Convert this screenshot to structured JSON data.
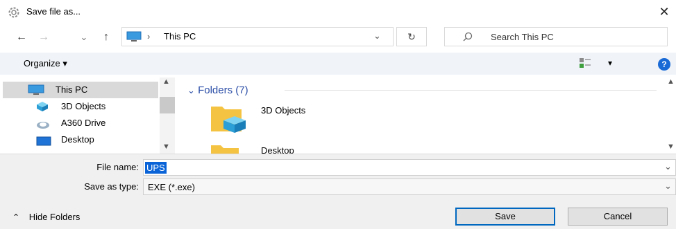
{
  "window": {
    "title": "Save file as...",
    "close_glyph": "✕",
    "icon": "gear-icon"
  },
  "nav": {
    "back_glyph": "←",
    "forward_glyph": "→",
    "recent_glyph": "⌄",
    "up_glyph": "↑",
    "address": {
      "separator": "›",
      "location": "This PC",
      "dropdown_glyph": "⌄"
    },
    "refresh_glyph": "↻",
    "search": {
      "placeholder": "Search This PC"
    }
  },
  "command_bar": {
    "organize_label": "Organize ▾",
    "view_dropdown_glyph": "▾",
    "help_glyph": "?"
  },
  "tree": [
    {
      "label": "This PC",
      "icon": "monitor-icon",
      "selected": true
    },
    {
      "label": "3D Objects",
      "icon": "cube-icon"
    },
    {
      "label": "A360 Drive",
      "icon": "cloud-drive-icon"
    },
    {
      "label": "Desktop",
      "icon": "desktop-icon"
    }
  ],
  "content": {
    "group_header": "Folders (7)",
    "items": [
      {
        "label": "3D Objects",
        "icon": "folder-3d-icon"
      },
      {
        "label": "Desktop",
        "icon": "folder-icon"
      }
    ]
  },
  "form": {
    "file_name_label": "File name:",
    "file_name_value": "UPS",
    "save_as_type_label": "Save as type:",
    "save_as_type_value": "EXE (*.exe)"
  },
  "footer": {
    "hide_folders_label": "Hide Folders",
    "save_label": "Save",
    "cancel_label": "Cancel"
  },
  "colors": {
    "accent": "#0067c0",
    "selection": "#0a64d8",
    "folder": "#f5c342",
    "folders_header": "#2a4da6"
  }
}
